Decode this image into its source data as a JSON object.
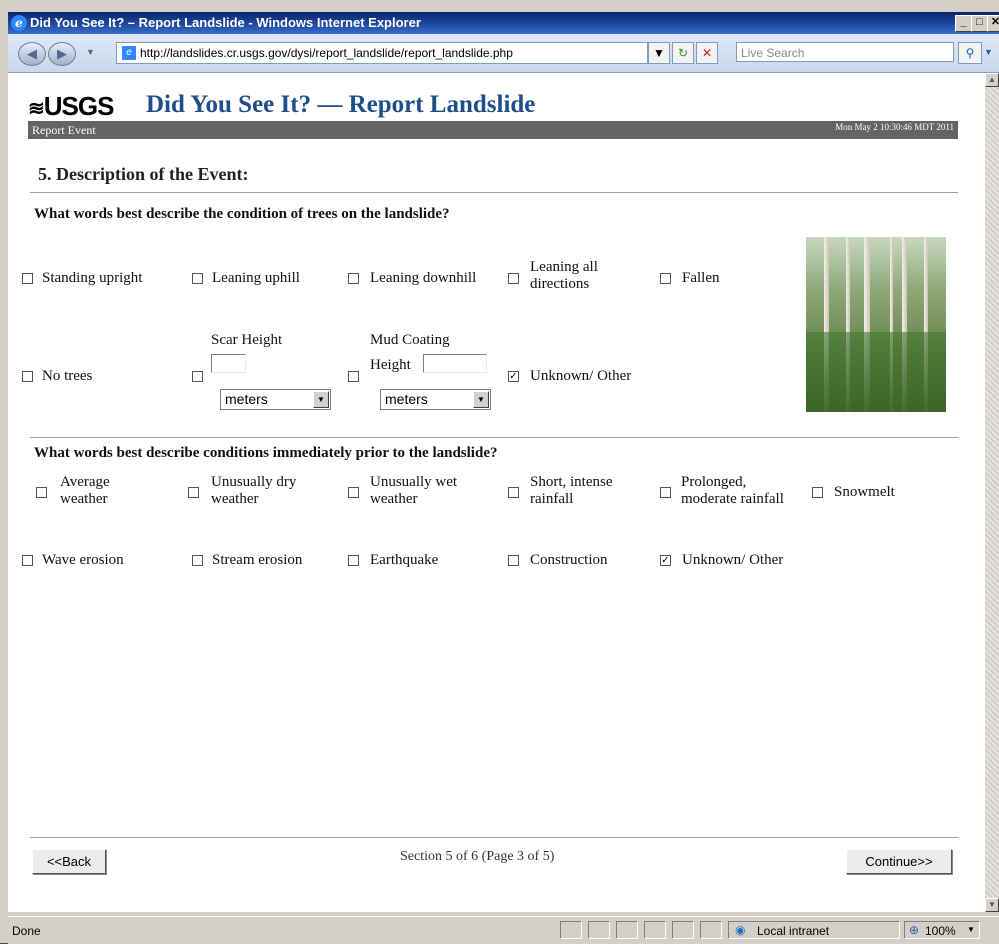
{
  "window": {
    "title": "Did You See It? – Report Landslide - Windows Internet Explorer"
  },
  "browser": {
    "url": "http://landslides.cr.usgs.gov/dysi/report_landslide/report_landslide.php",
    "search_placeholder": "Live Search",
    "status_text": "Done",
    "zone": "Local intranet",
    "zoom": "100%"
  },
  "header": {
    "logo": "USGS",
    "title": "Did You See It? — Report Landslide",
    "breadcrumb": "Report Event",
    "timestamp": "Mon May 2 10:30:46 MDT 2011"
  },
  "section": {
    "title": "5. Description of the Event:"
  },
  "q1": {
    "question": "What words best describe the condition of trees on the landslide?",
    "standing_upright": "Standing upright",
    "leaning_uphill": "Leaning uphill",
    "leaning_downhill": "Leaning downhill",
    "leaning_all_1": "Leaning all",
    "leaning_all_2": "directions",
    "fallen": "Fallen",
    "no_trees": "No trees",
    "scar_height": "Scar Height",
    "scar_unit": "meters",
    "mud_coating_1": "Mud Coating",
    "mud_coating_2": "Height",
    "mud_unit": "meters",
    "unknown_other": "Unknown/ Other",
    "unknown_checked": true
  },
  "q2": {
    "question": "What words best describe conditions immediately prior to the landslide?",
    "average_1": "Average",
    "average_2": "weather",
    "dry_1": "Unusually dry",
    "dry_2": "weather",
    "wet_1": "Unusually wet",
    "wet_2": "weather",
    "short_1": "Short, intense",
    "short_2": "rainfall",
    "prolonged_1": "Prolonged,",
    "prolonged_2": "moderate rainfall",
    "snowmelt": "Snowmelt",
    "wave_erosion": "Wave erosion",
    "stream_erosion": "Stream erosion",
    "earthquake": "Earthquake",
    "construction": "Construction",
    "unknown_other": "Unknown/ Other",
    "unknown_checked": true
  },
  "footer": {
    "back": "<<Back",
    "progress": "Section 5 of 6 (Page 3 of 5)",
    "continue": "Continue>>"
  },
  "icons": [
    "ie-logo-icon",
    "back-arrow-icon",
    "forward-arrow-icon",
    "refresh-icon",
    "stop-icon",
    "search-icon",
    "check-icon",
    "globe-intranet-icon",
    "zoom-icon"
  ]
}
